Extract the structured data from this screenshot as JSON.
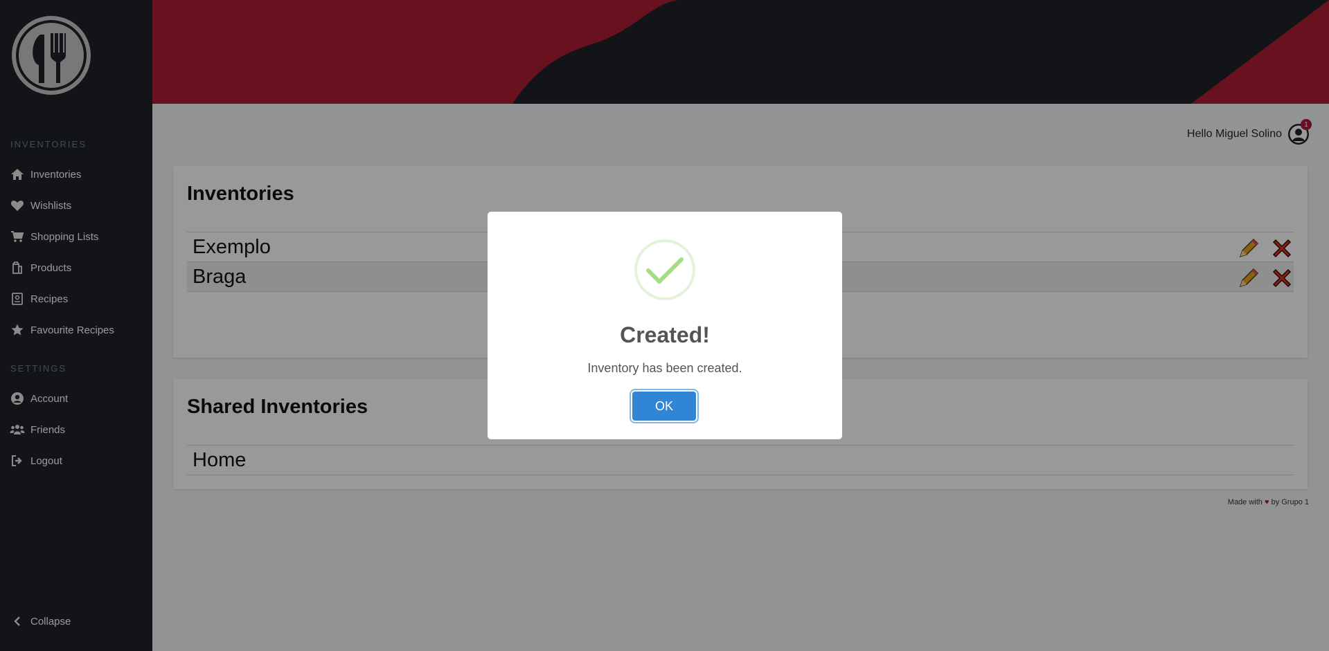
{
  "colors": {
    "sidebar_bg": "#1e2227",
    "banner_red": "#b01e35",
    "main_bg": "#f4f6f9",
    "accent_blue": "#3085d6",
    "success_green": "#a5dc86"
  },
  "sidebar": {
    "sections": [
      {
        "label": "INVENTORIES",
        "items": [
          {
            "label": "Inventories",
            "icon": "home-icon"
          },
          {
            "label": "Wishlists",
            "icon": "heart-icon"
          },
          {
            "label": "Shopping Lists",
            "icon": "cart-icon"
          },
          {
            "label": "Products",
            "icon": "products-icon"
          },
          {
            "label": "Recipes",
            "icon": "recipe-book-icon"
          },
          {
            "label": "Favourite Recipes",
            "icon": "star-icon"
          }
        ]
      },
      {
        "label": "SETTINGS",
        "items": [
          {
            "label": "Account",
            "icon": "user-circle-icon"
          },
          {
            "label": "Friends",
            "icon": "users-icon"
          },
          {
            "label": "Logout",
            "icon": "logout-icon"
          }
        ]
      }
    ],
    "collapse_label": "Collapse"
  },
  "header": {
    "greeting": "Hello Miguel Solino",
    "notification_count": "1"
  },
  "inventories": {
    "title": "Inventories",
    "items": [
      "Exemplo",
      "Braga"
    ]
  },
  "shared_inventories": {
    "title": "Shared Inventories",
    "items": [
      "Home"
    ]
  },
  "footer": {
    "made_with": "Made with",
    "heart": "♥",
    "by": "by Grupo 1"
  },
  "modal": {
    "title": "Created!",
    "text": "Inventory has been created.",
    "ok_label": "OK"
  }
}
